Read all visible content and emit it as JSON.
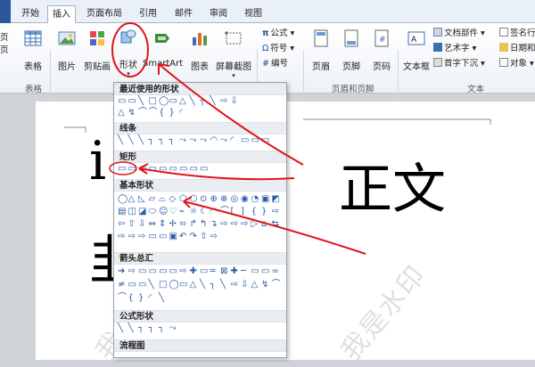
{
  "tabs": [
    "开始",
    "插入",
    "页面布局",
    "引用",
    "邮件",
    "审阅",
    "视图"
  ],
  "left_cut": {
    "l1": "页",
    "l2": "页"
  },
  "buttons": {
    "table": "表格",
    "picture": "图片",
    "clipart": "剪贴画",
    "shapes": "形状",
    "smartart": "SmartArt",
    "chart": "图表",
    "screenshot": "屏幕截图",
    "header": "页眉",
    "footer": "页脚",
    "pagenum": "页码",
    "textbox": "文本框"
  },
  "small": {
    "formula": "公式",
    "symbol": "符号",
    "number": "编号",
    "docparts": "文档部件",
    "wordart": "艺术字",
    "dropcap": "首字下沉",
    "signature": "签名行",
    "datetime": "日期和",
    "object": "对象"
  },
  "groups": {
    "tables": "表格",
    "header_footer": "页眉和页脚",
    "text": "文本"
  },
  "menu": {
    "recent": "最近使用的形状",
    "lines": "线条",
    "rect": "矩形",
    "basic": "基本形状",
    "arrows": "箭头总汇",
    "equation": "公式形状",
    "flowchart": "流程图"
  },
  "document": {
    "big_right": "正文",
    "big_left1": "i",
    "big_left2": "韭",
    "watermark": "我是水印"
  },
  "colors": {
    "accent": "#2b579a",
    "annotation": "#e0141a"
  }
}
